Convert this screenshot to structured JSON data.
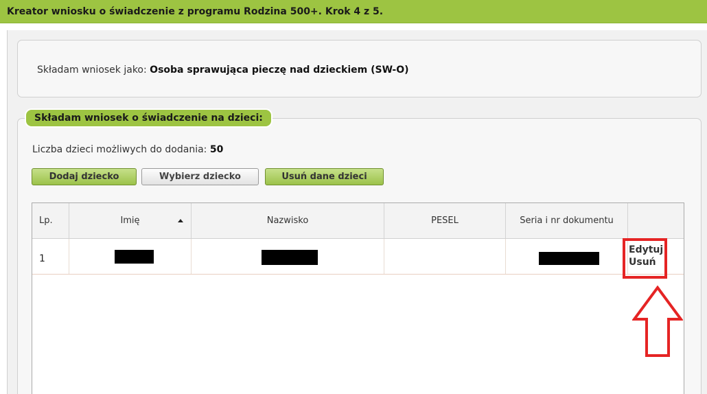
{
  "header": {
    "title": "Kreator wniosku o świadczenie z programu Rodzina 500+. Krok 4 z 5."
  },
  "applicant": {
    "prefix": "Składam wniosek jako:",
    "value": "Osoba sprawująca pieczę nad dzieckiem (SW-O)"
  },
  "children_section": {
    "legend": "Składam wniosek o świadczenie na dzieci:",
    "count_label": "Liczba dzieci możliwych do dodania:",
    "count_value": "50",
    "buttons": {
      "add": "Dodaj dziecko",
      "select": "Wybierz dziecko",
      "remove": "Usuń dane dzieci"
    }
  },
  "table": {
    "columns": [
      "Lp.",
      "Imię",
      "Nazwisko",
      "PESEL",
      "Seria i nr dokumentu",
      ""
    ],
    "sort_icon": "sort-ascending-icon",
    "rows": [
      {
        "lp": "1",
        "imie": "[redacted]",
        "nazwisko": "[redacted]",
        "pesel": "",
        "dokument": "[redacted]",
        "actions": {
          "edit": "Edytuj",
          "delete": "Usuń"
        }
      }
    ]
  },
  "annotation": {
    "color": "#e52424",
    "icon": "up-arrow-outline-icon"
  },
  "colors": {
    "accent": "#9dc442",
    "panel": "#f7f7f7",
    "highlight": "#e52424"
  }
}
